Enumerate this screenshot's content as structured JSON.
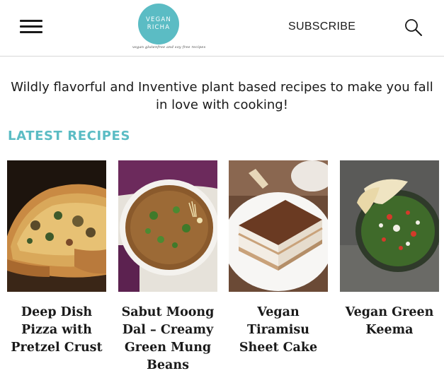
{
  "header": {
    "logo": {
      "line1": "VEGAN",
      "line2": "RICHA",
      "tagline": "vegan glutenfree and soy free recipes"
    },
    "subscribe_label": "SUBSCRIBE",
    "icons": {
      "menu": "hamburger-menu-icon",
      "search": "search-icon"
    }
  },
  "intro": {
    "tagline": "Wildly flavorful and Inventive plant based recipes to make you fall in love with cooking!"
  },
  "latest": {
    "title": "LATEST RECIPES",
    "recipes": [
      {
        "title": "Deep Dish Pizza with Pretzel Crust"
      },
      {
        "title": "Sabut Moong Dal – Creamy Green Mung Beans"
      },
      {
        "title": "Vegan Tiramisu Sheet Cake"
      },
      {
        "title": "Vegan Green Keema"
      }
    ]
  },
  "colors": {
    "accent": "#5bbcc4",
    "text": "#1a1a1a",
    "divider": "#d8d8d8"
  }
}
